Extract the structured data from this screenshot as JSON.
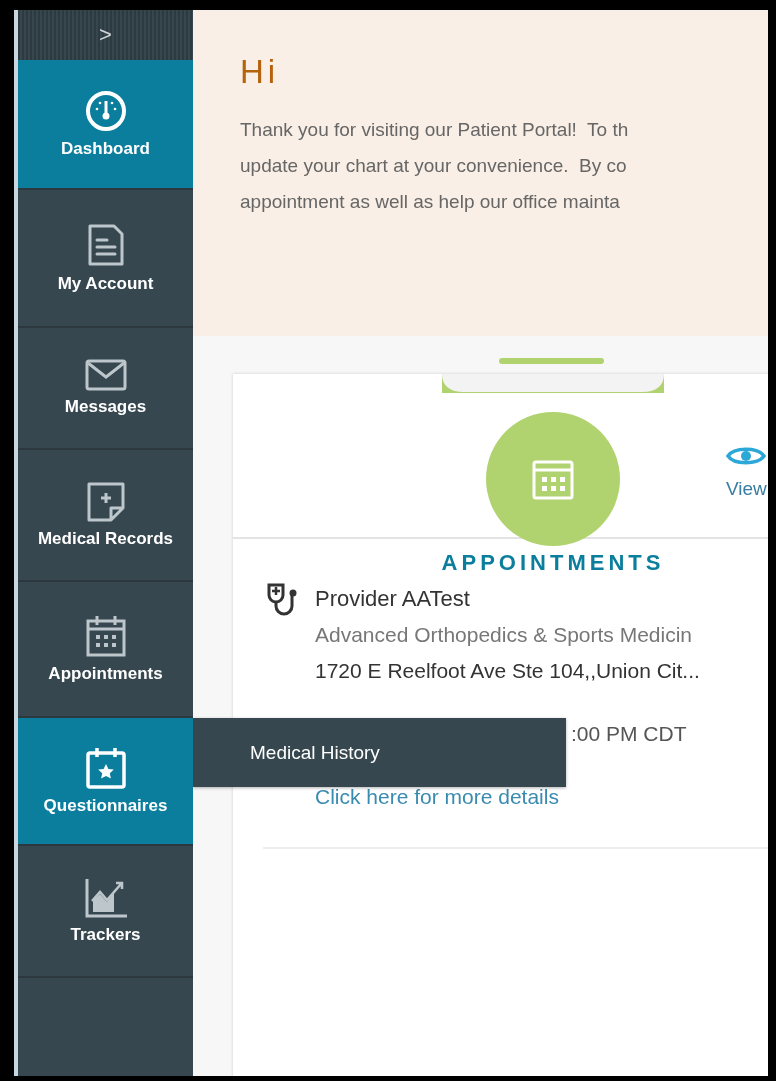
{
  "sidebar": {
    "toggle": ">",
    "items": [
      {
        "label": "Dashboard",
        "selected": true
      },
      {
        "label": "My Account",
        "selected": false
      },
      {
        "label": "Messages",
        "selected": false
      },
      {
        "label": "Medical Records",
        "selected": false
      },
      {
        "label": "Appointments",
        "selected": false
      },
      {
        "label": "Questionnaires",
        "selected": true
      },
      {
        "label": "Trackers",
        "selected": false
      }
    ]
  },
  "flyout": {
    "items": [
      "Medical History"
    ]
  },
  "welcome": {
    "title": "Hi",
    "lines": [
      "Thank you for visiting our Patient Portal!  To th",
      "update your chart at your convenience.  By co",
      "appointment as well as help our office mainta"
    ]
  },
  "card": {
    "title": "APPOINTMENTS",
    "view_label": "View",
    "appointment": {
      "provider": "Provider AATest",
      "practice": "Advanced Orthopedics & Sports Medicin",
      "address": "1720 E Reelfoot Ave Ste 104,,Union Cit...",
      "time": ":00 PM CDT",
      "link": "Click here for more details"
    }
  }
}
